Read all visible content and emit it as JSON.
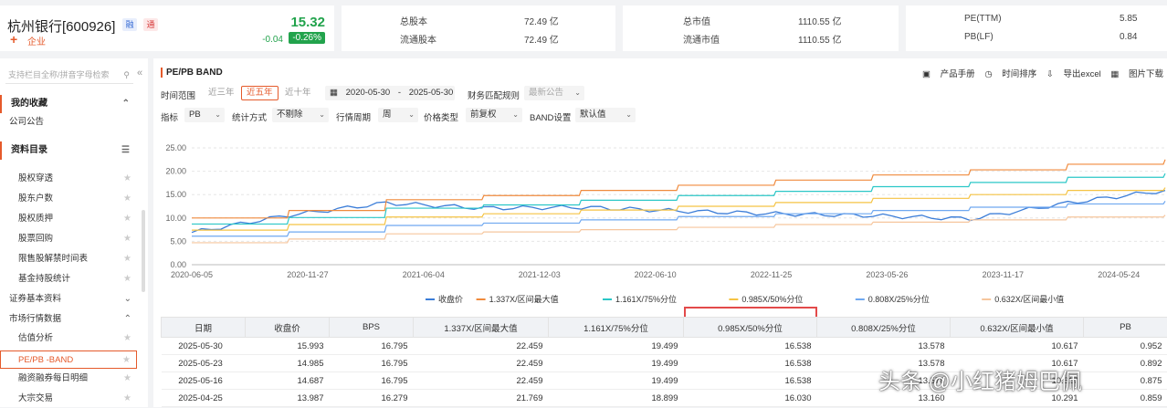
{
  "header": {
    "stock_name": "杭州银行[600926]",
    "tag_margin": "融",
    "tag_connect": "通",
    "price": "15.32",
    "change": "-0.04",
    "change_pct": "-0.26%",
    "enterprise": "企业",
    "metrics": [
      {
        "label": "总股本",
        "value": "72.49 亿"
      },
      {
        "label": "流通股本",
        "value": "72.49 亿"
      },
      {
        "label": "总市值",
        "value": "1110.55 亿"
      },
      {
        "label": "流通市值",
        "value": "1110.55 亿"
      },
      {
        "label": "PE(TTM)",
        "value": "5.85"
      },
      {
        "label": "PB(LF)",
        "value": "0.84"
      }
    ]
  },
  "sidebar": {
    "search_placeholder": "支持栏目全称/拼音字母检索",
    "favorites_title": "我的收藏",
    "favorites_item": "公司公告",
    "catalog_title": "资料目录",
    "items": [
      "股权穿透",
      "股东户数",
      "股权质押",
      "股票回购",
      "限售股解禁时间表",
      "基金持股统计"
    ],
    "sections": [
      "证券基本资料",
      "市场行情数据"
    ],
    "market_items": [
      "估值分析",
      "PE/PB -BAND",
      "融资融券每日明细",
      "大宗交易"
    ]
  },
  "main": {
    "title": "PE/PB BAND",
    "tools": [
      "产品手册",
      "时间排序",
      "导出excel",
      "图片下载"
    ],
    "time_range_label": "时间范围",
    "time_buttons": [
      "近三年",
      "近五年",
      "近十年"
    ],
    "date_start": "2020-05-30",
    "date_sep": "-",
    "date_end": "2025-05-30",
    "fin_rule_label": "财务匹配规则",
    "fin_rule_value": "最新公告",
    "indicator_label": "指标",
    "indicator_value": "PB",
    "stat_label": "统计方式",
    "stat_value": "不剔除",
    "period_label": "行情周期",
    "period_value": "周",
    "price_type_label": "价格类型",
    "price_type_value": "前复权",
    "band_label": "BAND设置",
    "band_value": "默认值"
  },
  "chart_data": {
    "type": "line",
    "x_ticks": [
      "2020-06-05",
      "2020-11-27",
      "2021-06-04",
      "2021-12-03",
      "2022-06-10",
      "2022-11-25",
      "2023-05-26",
      "2023-11-17",
      "2024-05-24"
    ],
    "y_ticks": [
      "0.00",
      "5.00",
      "10.00",
      "15.00",
      "20.00",
      "25.00"
    ],
    "ylim": [
      0,
      25
    ],
    "x": [
      0,
      10,
      20,
      30,
      40,
      50,
      60,
      70,
      80,
      90,
      100
    ],
    "series": [
      {
        "name": "收盘价",
        "color": "#3b7dd8",
        "values": [
          6.9,
          10.6,
          13.2,
          12.1,
          12.3,
          11.5,
          10.9,
          10.5,
          9.8,
          13.2,
          15.9
        ]
      },
      {
        "name": "1.337X/区间最大值",
        "color": "#f08a3c",
        "values": [
          10.0,
          11.6,
          13.9,
          14.8,
          15.9,
          17.0,
          18.1,
          19.2,
          20.3,
          21.5,
          22.5
        ]
      },
      {
        "name": "1.161X/75%分位",
        "color": "#2bc7c7",
        "values": [
          8.7,
          10.1,
          12.1,
          12.8,
          13.8,
          14.8,
          15.7,
          16.7,
          17.6,
          18.7,
          19.5
        ]
      },
      {
        "name": "0.985X/50%分位",
        "color": "#f5c343",
        "values": [
          7.4,
          8.6,
          10.2,
          10.9,
          11.7,
          12.5,
          13.3,
          14.2,
          15.0,
          15.9,
          16.5
        ]
      },
      {
        "name": "0.808X/25%分位",
        "color": "#6fa8f0",
        "values": [
          6.1,
          7.0,
          8.4,
          8.9,
          9.6,
          10.3,
          10.9,
          11.6,
          12.3,
          13.0,
          13.6
        ]
      },
      {
        "name": "0.632X/区间最小值",
        "color": "#f6c69d",
        "values": [
          4.7,
          5.5,
          6.6,
          7.0,
          7.5,
          8.0,
          8.6,
          9.1,
          9.6,
          10.2,
          10.6
        ]
      }
    ]
  },
  "table": {
    "headers": [
      "日期",
      "收盘价",
      "BPS",
      "1.337X/区间最大值",
      "1.161X/75%分位",
      "0.985X/50%分位",
      "0.808X/25%分位",
      "0.632X/区间最小值",
      "PB"
    ],
    "rows": [
      [
        "2025-05-30",
        "15.993",
        "16.795",
        "22.459",
        "19.499",
        "16.538",
        "13.578",
        "10.617",
        "0.952"
      ],
      [
        "2025-05-23",
        "14.985",
        "16.795",
        "22.459",
        "19.499",
        "16.538",
        "13.578",
        "10.617",
        "0.892"
      ],
      [
        "2025-05-16",
        "14.687",
        "16.795",
        "22.459",
        "19.499",
        "16.538",
        "13.578",
        "10.617",
        "0.875"
      ],
      [
        "2025-04-25",
        "13.987",
        "16.279",
        "21.769",
        "18.899",
        "16.030",
        "13.160",
        "10.291",
        "0.859"
      ]
    ]
  },
  "watermark": "头条 @小红猪姆巴佩"
}
